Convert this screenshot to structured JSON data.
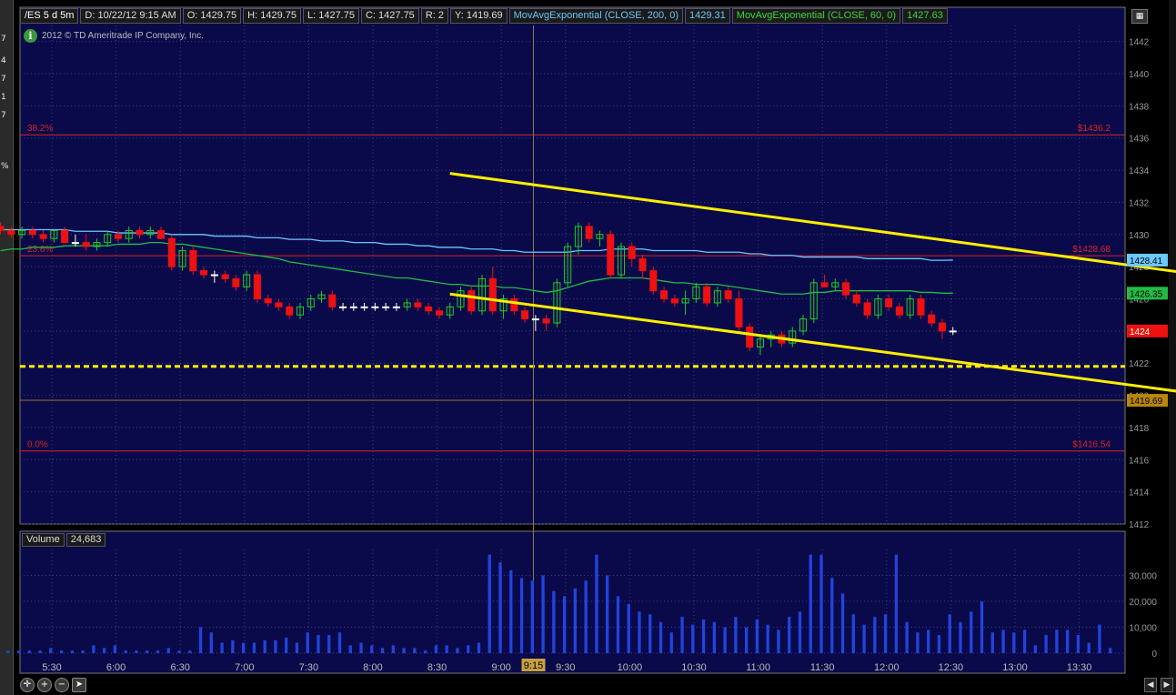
{
  "header": {
    "symbol": "/ES 5 d 5m",
    "date": "D: 10/22/12 9:15 AM",
    "open": "O: 1429.75",
    "high": "H: 1429.75",
    "low": "L: 1427.75",
    "close": "C: 1427.75",
    "range": "R: 2",
    "y": "Y: 1419.69",
    "ma200_label": "MovAvgExponential (CLOSE, 200, 0)",
    "ma200_value": "1429.31",
    "ma60_label": "MovAvgExponential (CLOSE, 60, 0)",
    "ma60_value": "1427.63"
  },
  "copyright": "2012 © TD Ameritrade IP Company, Inc.",
  "info_icon_text": "i",
  "volume_panel": {
    "label": "Volume",
    "value": "24,683"
  },
  "left_strip": [
    "7",
    "4",
    "7",
    "1",
    "7",
    "%"
  ],
  "colors": {
    "background": "#0a0a4a",
    "grid": "#3a3a8a",
    "up": "#22cc22",
    "down": "#ee1111",
    "trend": "#ffee00",
    "fib": "#dd2222",
    "ma200": "#6cc8ff",
    "ma60": "#22bb44",
    "volume": "#2244dd"
  },
  "chart_data": [
    {
      "type": "candlestick",
      "y_axis_ticks": [
        1412,
        1414,
        1416,
        1418,
        1420,
        1422,
        1424,
        1426,
        1428,
        1430,
        1432,
        1434,
        1436,
        1438,
        1440,
        1442
      ],
      "ylim": [
        1412,
        1443
      ],
      "x_ticks": [
        "5:30",
        "6:00",
        "6:30",
        "7:00",
        "7:30",
        "8:00",
        "8:30",
        "9:00",
        "9:30",
        "10:00",
        "10:30",
        "11:00",
        "11:30",
        "12:00",
        "12:30",
        "13:00",
        "13:30"
      ],
      "cursor_time": "9:15",
      "fib_levels": [
        {
          "label": "38.2%",
          "price": 1436.2,
          "price_label": "$1436.2"
        },
        {
          "label": "23.6%",
          "price": 1428.68,
          "price_label": "$1428.68"
        },
        {
          "label": "0.0%",
          "price": 1416.54,
          "price_label": "$1416.54"
        }
      ],
      "horizontal_lines": [
        {
          "price": 1421.8,
          "style": "dashed",
          "color": "#ffee00"
        },
        {
          "price": 1419.69,
          "style": "solid",
          "color": "#a07020",
          "badge": "1419.69"
        }
      ],
      "price_badges": [
        {
          "price": 1428.41,
          "text": "1428.41",
          "color": "#6cc8ff"
        },
        {
          "price": 1426.35,
          "text": "1426.35",
          "color": "#22bb44"
        },
        {
          "price": 1424,
          "text": "1424",
          "color": "#ee1111"
        }
      ],
      "trendlines": [
        {
          "t1": 42,
          "p1": 1433.8,
          "t2": 151,
          "p2": 1424.0
        },
        {
          "t1": 42,
          "p1": 1426.3,
          "t2": 151,
          "p2": 1416.6
        }
      ],
      "candles_start_index": 0,
      "candles": [
        [
          1430.5,
          1430.75,
          1430.0,
          1430.25
        ],
        [
          1430.25,
          1430.5,
          1429.75,
          1430.0
        ],
        [
          1430.0,
          1430.5,
          1429.75,
          1430.25
        ],
        [
          1430.25,
          1430.5,
          1429.75,
          1430.0
        ],
        [
          1430.0,
          1430.25,
          1429.5,
          1429.75
        ],
        [
          1429.75,
          1430.25,
          1429.5,
          1430.25
        ],
        [
          1430.25,
          1430.5,
          1429.5,
          1429.5
        ],
        [
          1429.5,
          1430.0,
          1429.25,
          1429.5
        ],
        [
          1429.5,
          1430.0,
          1429.0,
          1429.25
        ],
        [
          1429.25,
          1429.75,
          1429.0,
          1429.5
        ],
        [
          1429.5,
          1430.25,
          1429.25,
          1430.0
        ],
        [
          1430.0,
          1430.25,
          1429.5,
          1429.75
        ],
        [
          1429.75,
          1430.5,
          1429.5,
          1430.25
        ],
        [
          1430.25,
          1430.5,
          1429.75,
          1430.0
        ],
        [
          1430.0,
          1430.5,
          1429.75,
          1430.25
        ],
        [
          1430.25,
          1430.5,
          1429.75,
          1429.75
        ],
        [
          1429.75,
          1430.0,
          1427.75,
          1428.0
        ],
        [
          1428.0,
          1429.25,
          1427.75,
          1429.0
        ],
        [
          1429.0,
          1429.25,
          1427.5,
          1427.75
        ],
        [
          1427.75,
          1428.0,
          1427.25,
          1427.5
        ],
        [
          1427.5,
          1427.75,
          1427.0,
          1427.5
        ],
        [
          1427.5,
          1427.75,
          1427.0,
          1427.25
        ],
        [
          1427.25,
          1427.5,
          1426.5,
          1426.75
        ],
        [
          1426.75,
          1427.75,
          1426.5,
          1427.5
        ],
        [
          1427.5,
          1427.75,
          1425.75,
          1426.0
        ],
        [
          1426.0,
          1426.25,
          1425.5,
          1425.75
        ],
        [
          1425.75,
          1426.0,
          1425.25,
          1425.5
        ],
        [
          1425.5,
          1425.75,
          1424.75,
          1425.0
        ],
        [
          1425.0,
          1425.75,
          1424.75,
          1425.5
        ],
        [
          1425.5,
          1426.25,
          1425.25,
          1426.0
        ],
        [
          1426.0,
          1426.5,
          1425.75,
          1426.25
        ],
        [
          1426.25,
          1426.5,
          1425.25,
          1425.5
        ],
        [
          1425.5,
          1425.75,
          1425.25,
          1425.5
        ],
        [
          1425.5,
          1425.75,
          1425.25,
          1425.5
        ],
        [
          1425.5,
          1425.75,
          1425.25,
          1425.5
        ],
        [
          1425.5,
          1425.75,
          1425.25,
          1425.5
        ],
        [
          1425.5,
          1425.75,
          1425.25,
          1425.5
        ],
        [
          1425.5,
          1425.75,
          1425.25,
          1425.5
        ],
        [
          1425.5,
          1426.0,
          1425.25,
          1425.75
        ],
        [
          1425.75,
          1426.0,
          1425.25,
          1425.5
        ],
        [
          1425.5,
          1425.75,
          1425.0,
          1425.25
        ],
        [
          1425.25,
          1425.5,
          1424.75,
          1425.0
        ],
        [
          1425.0,
          1425.75,
          1424.75,
          1425.5
        ],
        [
          1425.5,
          1426.75,
          1425.25,
          1426.5
        ],
        [
          1426.5,
          1426.75,
          1425.0,
          1425.25
        ],
        [
          1425.25,
          1427.5,
          1425.0,
          1427.25
        ],
        [
          1427.25,
          1428.0,
          1425.0,
          1425.25
        ],
        [
          1425.25,
          1426.25,
          1424.75,
          1426.0
        ],
        [
          1426.0,
          1426.25,
          1425.0,
          1425.25
        ],
        [
          1425.25,
          1425.5,
          1424.5,
          1424.75
        ],
        [
          1424.75,
          1425.0,
          1424.0,
          1424.75
        ],
        [
          1424.75,
          1425.0,
          1424.0,
          1424.5
        ],
        [
          1424.5,
          1427.25,
          1424.25,
          1427.0
        ],
        [
          1427.0,
          1429.5,
          1426.75,
          1429.25
        ],
        [
          1429.25,
          1430.75,
          1428.75,
          1430.5
        ],
        [
          1430.5,
          1430.75,
          1429.5,
          1429.75
        ],
        [
          1429.75,
          1430.25,
          1429.25,
          1430.0
        ],
        [
          1430.0,
          1430.25,
          1427.25,
          1427.5
        ],
        [
          1427.5,
          1429.5,
          1427.25,
          1429.25
        ],
        [
          1429.25,
          1429.5,
          1428.0,
          1428.5
        ],
        [
          1428.5,
          1428.75,
          1427.25,
          1427.75
        ],
        [
          1427.75,
          1428.0,
          1426.25,
          1426.5
        ],
        [
          1426.5,
          1426.75,
          1425.75,
          1426.0
        ],
        [
          1426.0,
          1426.25,
          1425.5,
          1425.75
        ],
        [
          1425.75,
          1426.5,
          1425.0,
          1426.0
        ],
        [
          1426.0,
          1427.0,
          1425.75,
          1426.75
        ],
        [
          1426.75,
          1427.0,
          1425.5,
          1425.75
        ],
        [
          1425.75,
          1426.75,
          1425.5,
          1426.5
        ],
        [
          1426.5,
          1426.75,
          1425.75,
          1426.0
        ],
        [
          1426.0,
          1426.5,
          1424.0,
          1424.25
        ],
        [
          1424.25,
          1424.5,
          1422.75,
          1423.0
        ],
        [
          1423.0,
          1423.75,
          1422.5,
          1423.5
        ],
        [
          1423.5,
          1424.0,
          1423.0,
          1423.75
        ],
        [
          1423.75,
          1424.0,
          1423.0,
          1423.25
        ],
        [
          1423.25,
          1424.25,
          1423.0,
          1424.0
        ],
        [
          1424.0,
          1425.0,
          1423.75,
          1424.75
        ],
        [
          1424.75,
          1427.25,
          1424.5,
          1427.0
        ],
        [
          1427.0,
          1427.5,
          1426.75,
          1426.75
        ],
        [
          1426.75,
          1427.25,
          1426.5,
          1427.0
        ],
        [
          1427.0,
          1427.25,
          1426.0,
          1426.25
        ],
        [
          1426.25,
          1426.5,
          1425.5,
          1425.75
        ],
        [
          1425.75,
          1426.0,
          1424.75,
          1425.0
        ],
        [
          1425.0,
          1426.25,
          1424.75,
          1426.0
        ],
        [
          1426.0,
          1426.25,
          1425.25,
          1425.5
        ],
        [
          1425.5,
          1425.75,
          1424.75,
          1425.0
        ],
        [
          1425.0,
          1426.25,
          1424.75,
          1426.0
        ],
        [
          1426.0,
          1426.25,
          1424.75,
          1425.0
        ],
        [
          1425.0,
          1425.25,
          1424.25,
          1424.5
        ],
        [
          1424.5,
          1424.75,
          1423.5,
          1424.0
        ],
        [
          1424.0,
          1424.25,
          1423.75,
          1424.0
        ]
      ],
      "ma200": [
        1430.3,
        1430.3,
        1430.3,
        1430.3,
        1430.3,
        1430.3,
        1430.3,
        1430.2,
        1430.2,
        1430.2,
        1430.2,
        1430.1,
        1430.1,
        1430.1,
        1430.1,
        1430.1,
        1430.0,
        1430.0,
        1430.0,
        1430.0,
        1429.9,
        1429.9,
        1429.9,
        1429.9,
        1429.8,
        1429.8,
        1429.8,
        1429.7,
        1429.7,
        1429.7,
        1429.6,
        1429.6,
        1429.6,
        1429.5,
        1429.5,
        1429.5,
        1429.4,
        1429.4,
        1429.4,
        1429.3,
        1429.3,
        1429.2,
        1429.2,
        1429.2,
        1429.1,
        1429.1,
        1429.1,
        1429.0,
        1429.0,
        1428.9,
        1428.9,
        1428.9,
        1428.9,
        1428.9,
        1429.0,
        1429.0,
        1429.0,
        1429.1,
        1429.1,
        1429.1,
        1429.1,
        1429.0,
        1429.0,
        1429.0,
        1429.0,
        1429.0,
        1428.9,
        1428.9,
        1428.9,
        1428.9,
        1428.8,
        1428.8,
        1428.7,
        1428.7,
        1428.7,
        1428.6,
        1428.6,
        1428.6,
        1428.6,
        1428.6,
        1428.6,
        1428.5,
        1428.5,
        1428.5,
        1428.5,
        1428.5,
        1428.5,
        1428.4,
        1428.4,
        1428.41
      ],
      "ma60": [
        1429.0,
        1429.1,
        1429.1,
        1429.2,
        1429.2,
        1429.2,
        1429.3,
        1429.3,
        1429.3,
        1429.3,
        1429.3,
        1429.4,
        1429.4,
        1429.4,
        1429.5,
        1429.5,
        1429.4,
        1429.4,
        1429.3,
        1429.2,
        1429.1,
        1429.0,
        1428.9,
        1428.8,
        1428.7,
        1428.6,
        1428.5,
        1428.3,
        1428.2,
        1428.1,
        1428.0,
        1427.9,
        1427.8,
        1427.7,
        1427.6,
        1427.5,
        1427.4,
        1427.3,
        1427.3,
        1427.2,
        1427.1,
        1427.0,
        1426.9,
        1426.9,
        1426.8,
        1426.8,
        1426.8,
        1426.7,
        1426.7,
        1426.6,
        1426.5,
        1426.4,
        1426.5,
        1426.7,
        1426.9,
        1427.1,
        1427.2,
        1427.3,
        1427.3,
        1427.3,
        1427.3,
        1427.2,
        1427.1,
        1427.0,
        1427.0,
        1426.9,
        1426.9,
        1426.9,
        1426.8,
        1426.7,
        1426.6,
        1426.5,
        1426.4,
        1426.3,
        1426.3,
        1426.3,
        1426.4,
        1426.4,
        1426.5,
        1426.5,
        1426.5,
        1426.5,
        1426.5,
        1426.5,
        1426.5,
        1426.5,
        1426.4,
        1426.4,
        1426.35,
        1426.35
      ]
    },
    {
      "type": "bar",
      "title": "Volume",
      "y_axis_ticks": [
        "0",
        "10,000",
        "20,000",
        "30,000"
      ],
      "ylim": [
        0,
        40000
      ],
      "values": [
        1000,
        1000,
        2000,
        1000,
        1000,
        1000,
        1000,
        2000,
        1000,
        1000,
        1000,
        3000,
        2000,
        3000,
        1000,
        1000,
        1000,
        1000,
        2000,
        1000,
        1000,
        10000,
        8000,
        4000,
        5000,
        4000,
        4000,
        5000,
        5000,
        6000,
        4000,
        8000,
        7000,
        7000,
        8000,
        3000,
        4000,
        3000,
        2000,
        3000,
        2000,
        2000,
        1000,
        3000,
        3000,
        2000,
        3000,
        4000,
        38000,
        35000,
        32000,
        29000,
        28000,
        30000,
        24000,
        22000,
        25000,
        28000,
        38000,
        30000,
        22000,
        19000,
        16000,
        15000,
        12000,
        8000,
        14000,
        11000,
        13000,
        12000,
        10000,
        14000,
        10000,
        13000,
        11000,
        9000,
        14000,
        16000,
        38000,
        38000,
        29000,
        23000,
        15000,
        11000,
        14000,
        15000,
        38000,
        12000,
        8000,
        9000,
        7000,
        15000,
        12000,
        16000,
        20000,
        8000,
        9000,
        8000,
        9000,
        3000,
        7000,
        9000,
        9000,
        7000,
        4000,
        11000,
        2000
      ]
    }
  ]
}
